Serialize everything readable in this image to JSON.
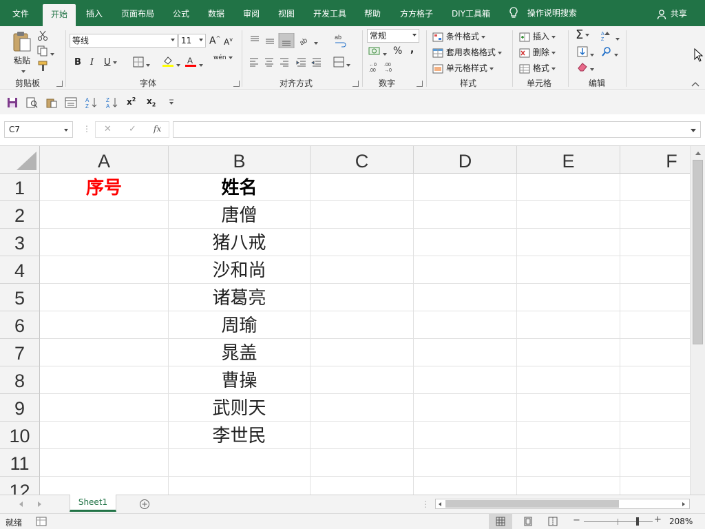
{
  "tabs": [
    {
      "label": "文件",
      "active": false
    },
    {
      "label": "开始",
      "active": true
    },
    {
      "label": "插入",
      "active": false
    },
    {
      "label": "页面布局",
      "active": false
    },
    {
      "label": "公式",
      "active": false
    },
    {
      "label": "数据",
      "active": false
    },
    {
      "label": "审阅",
      "active": false
    },
    {
      "label": "视图",
      "active": false
    },
    {
      "label": "开发工具",
      "active": false
    },
    {
      "label": "帮助",
      "active": false
    },
    {
      "label": "方方格子",
      "active": false
    },
    {
      "label": "DIY工具箱",
      "active": false
    }
  ],
  "tell_me": "操作说明搜索",
  "share_label": "共享",
  "ribbon": {
    "clipboard": {
      "paste_label": "粘贴",
      "group_label": "剪贴板"
    },
    "font": {
      "font_name": "等线",
      "font_size": "11",
      "phonetic_label": "wén",
      "group_label": "字体"
    },
    "alignment": {
      "group_label": "对齐方式"
    },
    "number": {
      "format_value": "常规",
      "percent_label": "%",
      "comma_label": ",",
      "group_label": "数字"
    },
    "styles": {
      "conditional_label": "条件格式",
      "table_label": "套用表格格式",
      "cell_styles_label": "单元格样式",
      "group_label": "样式"
    },
    "cells": {
      "insert_label": "插入",
      "delete_label": "删除",
      "format_label": "格式",
      "group_label": "单元格"
    },
    "editing": {
      "group_label": "编辑"
    }
  },
  "name_box": "C7",
  "formula_bar": {
    "fx_label": "fx",
    "value": ""
  },
  "columns": [
    "A",
    "B",
    "C",
    "D",
    "E",
    "F"
  ],
  "rows": [
    "1",
    "2",
    "3",
    "4",
    "5",
    "6",
    "7",
    "8",
    "9",
    "10",
    "11",
    "12"
  ],
  "cells": {
    "A1": "序号",
    "B1": "姓名",
    "B2": "唐僧",
    "B3": "猪八戒",
    "B4": "沙和尚",
    "B5": "诸葛亮",
    "B6": "周瑜",
    "B7": "晁盖",
    "B8": "曹操",
    "B9": "武则天",
    "B10": "李世民"
  },
  "sheet_tab": "Sheet1",
  "status": {
    "mode": "就绪",
    "zoom": "208%",
    "zoom_fraction": 0.78
  },
  "colors": {
    "brand": "#217346",
    "header_red": "#ff0000"
  }
}
